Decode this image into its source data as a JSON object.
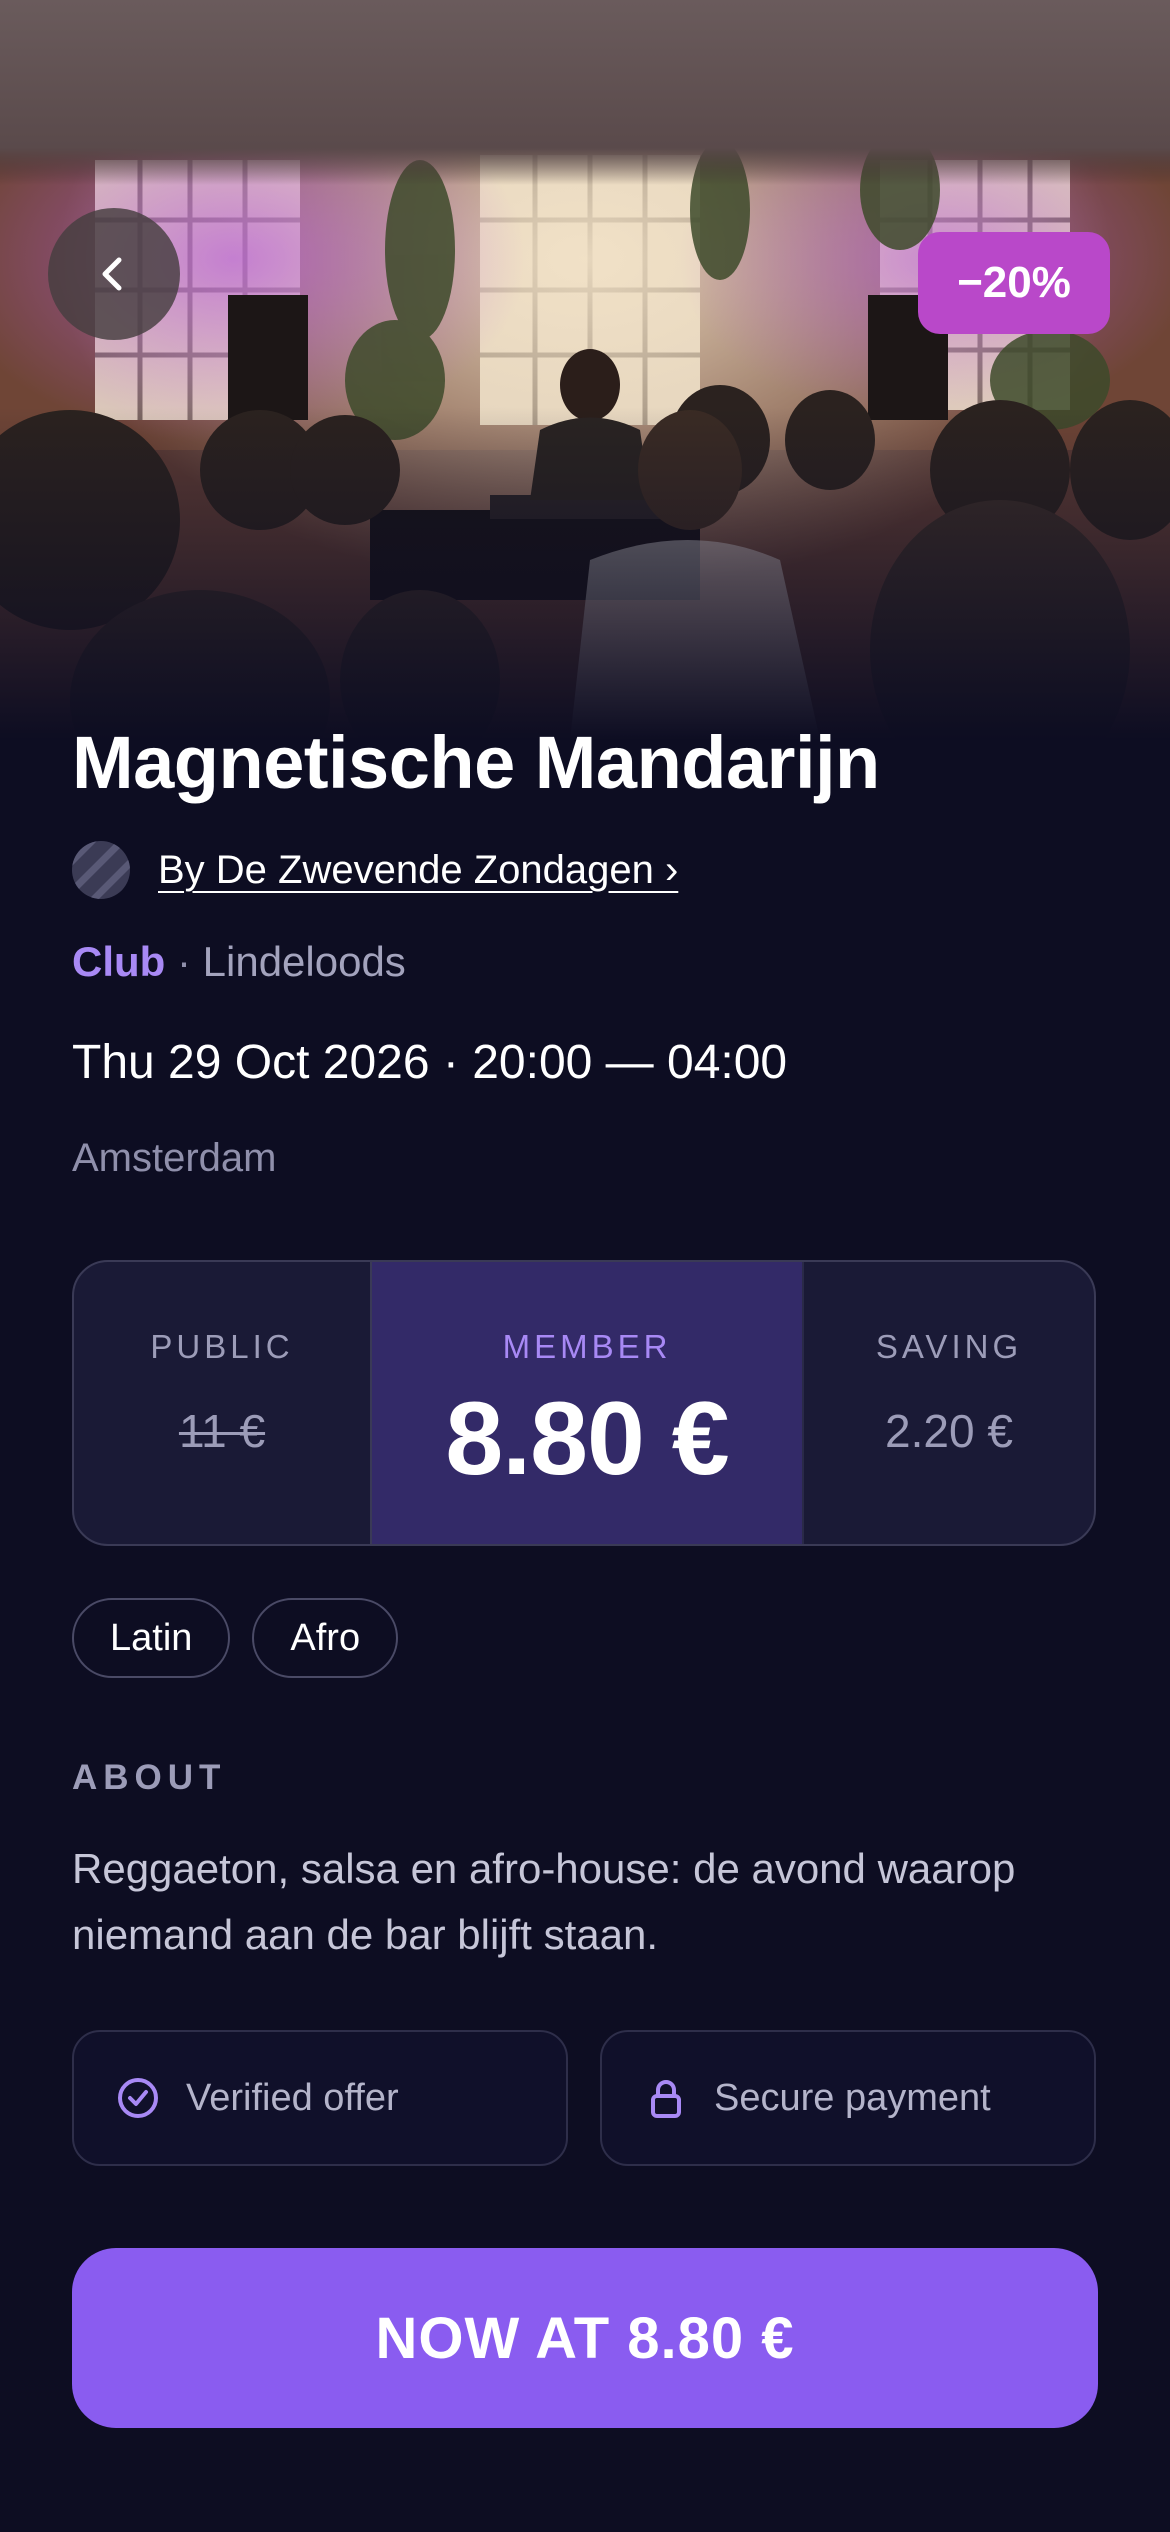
{
  "hero": {
    "image_name": "crowded-club-dj-photo",
    "back_icon": "chevron-left-icon",
    "discount_badge": "−20%"
  },
  "event": {
    "title": "Magnetische Mandarijn",
    "organizer_avatar": "striped-avatar",
    "organizer_link": "By De Zwevende Zondagen ›",
    "category": "Club",
    "separator": " · ",
    "venue": "Lindeloods",
    "datetime": "Thu 29 Oct 2026 · 20:00 — 04:00",
    "city": "Amsterdam"
  },
  "pricing": {
    "public_label": "PUBLIC",
    "public_value": "11 €",
    "member_label": "MEMBER",
    "member_value": "8.80 €",
    "saving_label": "SAVING",
    "saving_value": "2.20 €"
  },
  "tags": [
    "Latin",
    "Afro"
  ],
  "about": {
    "heading": "ABOUT",
    "text": "Reggaeton, salsa en afro-house: de avond waarop niemand aan de bar blijft staan."
  },
  "trust": {
    "verified_icon": "check-circle-icon",
    "verified_label": "Verified offer",
    "secure_icon": "lock-icon",
    "secure_label": "Secure payment"
  },
  "cta": {
    "label": "NOW AT 8.80 €"
  },
  "colors": {
    "background": "#0d0d22",
    "accent": "#8a5cf0",
    "accent_text": "#a889f5",
    "badge": "#b948c9",
    "member_highlight": "#332a68"
  }
}
